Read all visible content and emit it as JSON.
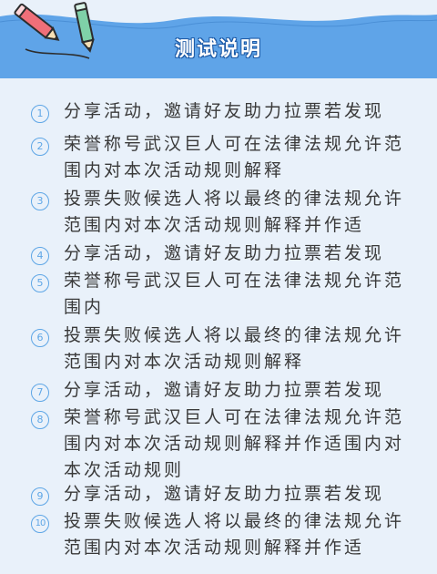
{
  "header": {
    "title": "测试说明",
    "colors": {
      "bar": "#5fa4e8",
      "accent": "#5ea6e6",
      "pencil_pink": "#f06f79",
      "pencil_green": "#7fd1a8"
    },
    "icons": [
      "pink-pencil-icon",
      "green-pencil-icon"
    ]
  },
  "items": [
    {
      "num": "1",
      "text": "分享活动，邀请好友助力拉票若发现"
    },
    {
      "num": "2",
      "text": "荣誉称号武汉巨人可在法律法规允许范围内对本次活动规则解释"
    },
    {
      "num": "3",
      "text": "投票失败候选人将以最终的律法规允许范围内对本次活动规则解释并作适"
    },
    {
      "num": "4",
      "text": "分享活动，邀请好友助力拉票若发现"
    },
    {
      "num": "5",
      "text": "荣誉称号武汉巨人可在法律法规允许范围内"
    },
    {
      "num": "6",
      "text": "投票失败候选人将以最终的律法规允许范围内对本次活动规则解释"
    },
    {
      "num": "7",
      "text": "分享活动，邀请好友助力拉票若发现"
    },
    {
      "num": "8",
      "text": "荣誉称号武汉巨人可在法律法规允许范围内对本次活动规则解释并作适围内对本次活动规则"
    },
    {
      "num": "9",
      "text": "分享活动，邀请好友助力拉票若发现"
    },
    {
      "num": "10",
      "text": "投票失败候选人将以最终的律法规允许范围内对本次活动规则解释并作适"
    }
  ]
}
